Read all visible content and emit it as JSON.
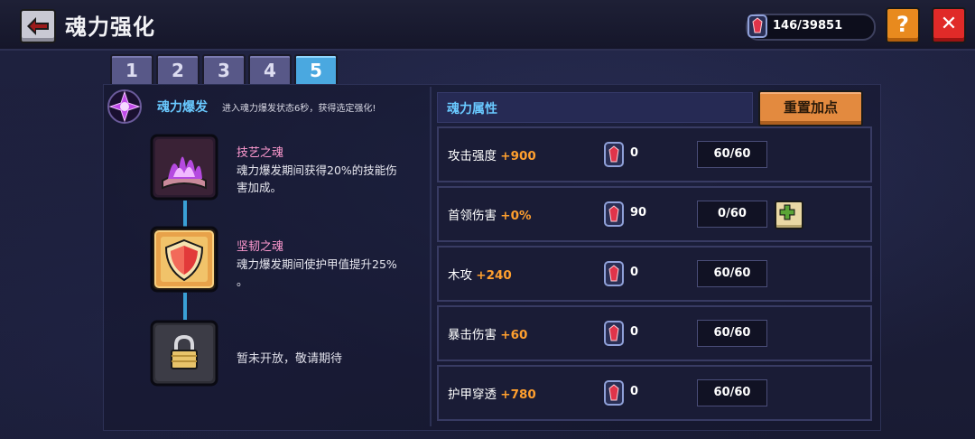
{
  "header": {
    "title": "魂力强化",
    "currency": "146/39851",
    "help_label": "?",
    "close_label": "✕"
  },
  "tabs": [
    "1",
    "2",
    "3",
    "4",
    "5"
  ],
  "active_tab": "5",
  "burst": {
    "title": "魂力爆发",
    "desc": "进入魂力爆发状态6秒，获得选定强化!"
  },
  "skills": [
    {
      "name": "技艺之魂",
      "desc_line1": "魂力爆发期间获得20%的技能伤",
      "desc_line2": "害加成。"
    },
    {
      "name": "坚韧之魂",
      "desc_line1": "魂力爆发期间使护甲值提升25%",
      "desc_line2": "。"
    }
  ],
  "locked_text": "暂未开放，敬请期待",
  "attributes": {
    "header": "魂力属性",
    "reset_label": "重置加点",
    "rows": [
      {
        "name": "攻击强度",
        "bonus": "+900",
        "count": "0",
        "level": "60/60"
      },
      {
        "name": "首领伤害",
        "bonus": "+0%",
        "count": "90",
        "level": "0/60"
      },
      {
        "name": "木攻",
        "bonus": "+240",
        "count": "0",
        "level": "60/60"
      },
      {
        "name": "暴击伤害",
        "bonus": "+60",
        "count": "0",
        "level": "60/60"
      },
      {
        "name": "护甲穿透",
        "bonus": "+780",
        "count": "0",
        "level": "60/60"
      }
    ]
  },
  "colors": {
    "accent_blue": "#69c9ff",
    "bonus_orange": "#ff9f2e",
    "skill_pink": "#ff9ad0",
    "active_tab": "#4aa8e0",
    "close_red": "#e02a28",
    "help_orange": "#e88a1e"
  }
}
